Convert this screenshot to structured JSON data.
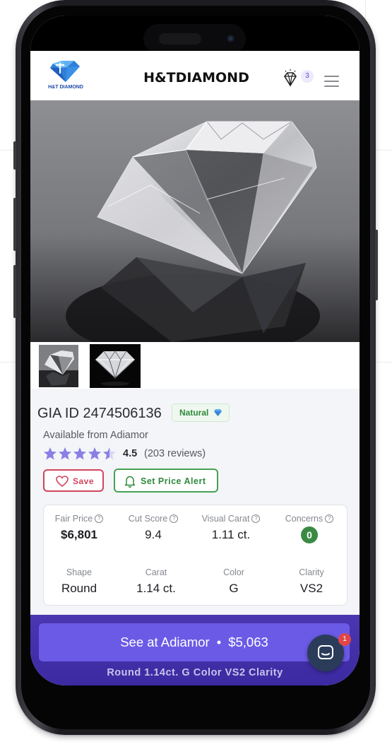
{
  "header": {
    "logo_text": "H&T DIAMOND",
    "brand": "H&TDIAMOND",
    "cart_count": "3"
  },
  "product": {
    "gia_id": "GIA ID 2474506136",
    "badge": "Natural",
    "available": "Available from Adiamor",
    "rating_value": "4.5",
    "reviews": "(203 reviews)",
    "rating_stars": 4.5
  },
  "actions": {
    "save_label": "Save",
    "alert_label": "Set Price Alert"
  },
  "specs": {
    "fair_price_label": "Fair Price",
    "fair_price_value": "$6,801",
    "cut_score_label": "Cut Score",
    "cut_score_value": "9.4",
    "visual_carat_label": "Visual Carat",
    "visual_carat_value": "1.11 ct.",
    "concerns_label": "Concerns",
    "concerns_value": "0",
    "shape_label": "Shape",
    "shape_value": "Round",
    "carat_label": "Carat",
    "carat_value": "1.14 ct.",
    "color_label": "Color",
    "color_value": "G",
    "clarity_label": "Clarity",
    "clarity_value": "VS2"
  },
  "cta": {
    "label": "See at Adiamor",
    "separator": "•",
    "price": "$5,063",
    "subtitle": "Round 1.14ct. G Color VS2 Clarity"
  },
  "chat": {
    "badge": "1"
  },
  "colors": {
    "accent": "#6b5ae6",
    "cta_bar": "#3b2aa1",
    "save": "#d1455c",
    "alert": "#45a254",
    "concern_ok": "#3a8a44"
  }
}
